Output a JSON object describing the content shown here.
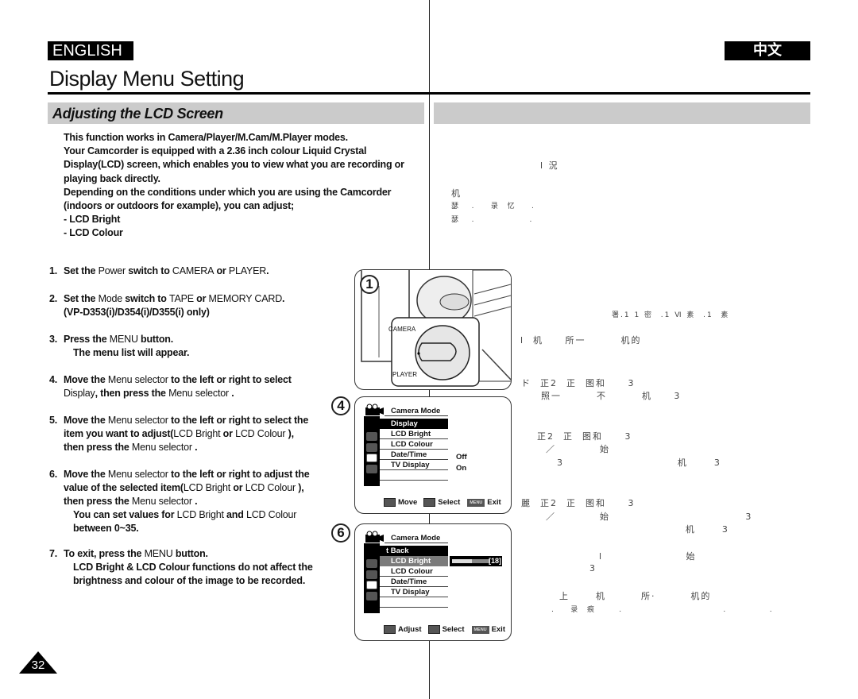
{
  "header": {
    "lang_left": "ENGLISH",
    "lang_right": "中文",
    "title": "Display Menu Setting",
    "section_title": "Adjusting the LCD Screen"
  },
  "intro": {
    "lines": [
      "This function works in Camera/Player/M.Cam/M.Player modes.",
      "Your Camcorder is equipped with a 2.36 inch colour Liquid Crystal",
      "Display(LCD) screen, which enables you to view what you are recording or",
      "playing back directly.",
      "Depending on the conditions under which you are using the Camcorder",
      "(indoors or outdoors for example), you can adjust;",
      "-  LCD Bright",
      "-  LCD Colour"
    ]
  },
  "steps": [
    {
      "num": "1.",
      "a": "Set the ",
      "b": "Power",
      "c": " switch to ",
      "d": "CAMERA",
      "e": " or ",
      "f": "PLAYER",
      "g": "."
    },
    {
      "num": "2.",
      "a": "Set the ",
      "b": "Mode",
      "c": " switch to ",
      "d": "TAPE",
      "e": " or ",
      "f": "MEMORY CARD",
      "g": ".",
      "sub": "(VP-D353(i)/D354(i)/D355(i) only)"
    },
    {
      "num": "3.",
      "a": "Press the ",
      "b": "MENU",
      "c": " button.",
      "sub": "The menu list will appear."
    },
    {
      "num": "4.",
      "a": "Move the ",
      "b": "Menu selector",
      "c": " to the left or right to select",
      "d2": "Display",
      "e2": ", then press the ",
      "f2": "Menu selector",
      "g2": " ."
    },
    {
      "num": "5.",
      "a": "Move the ",
      "b": "Menu selector",
      "c": " to the left or right to select the",
      "l2a": "item you want to adjust(",
      "l2b": "LCD Bright",
      "l2c": " or ",
      "l2d": "LCD Colour",
      "l2e": " ),",
      "l3a": "then press the ",
      "l3b": "Menu selector",
      "l3c": " ."
    },
    {
      "num": "6.",
      "a": "Move the ",
      "b": "Menu selector",
      "c": " to the left or right to adjust the",
      "l2a": "value of the selected item(",
      "l2b": "LCD Bright",
      "l2c": " or ",
      "l2d": "LCD Colour",
      "l2e": " ),",
      "l3a": "then press the ",
      "l3b": "Menu selector",
      "l3c": " .",
      "s1a": "You can set values for ",
      "s1b": "LCD Bright",
      "s1c": " and ",
      "s1d": "LCD Colour",
      "s2": "between 0~35."
    },
    {
      "num": "7.",
      "a": "To exit, press the ",
      "b": "MENU",
      "c": " button.",
      "s1": "LCD Bright & LCD Colour functions do not affect the",
      "s2": "brightness and colour of the image to be recorded."
    }
  ],
  "figures": {
    "fig1": {
      "label": "1",
      "dial_top": "CAMERA",
      "dial_bottom": "PLAYER"
    },
    "fig4": {
      "label": "4",
      "header": "Camera Mode",
      "items": [
        "Display",
        "LCD Bright",
        "LCD Colour",
        "Date/Time",
        "TV Display"
      ],
      "selected": "Display",
      "values": {
        "Date/Time": "Off",
        "TV Display": "On"
      },
      "footer": {
        "move": "Move",
        "select": "Select",
        "menu_key": "MENU",
        "exit": "Exit"
      }
    },
    "fig6": {
      "label": "6",
      "header": "Camera Mode",
      "items": [
        "t Back",
        "LCD Bright",
        "LCD Colour",
        "Date/Time",
        "TV Display"
      ],
      "highlighted": "LCD Bright",
      "slider": {
        "value": 18,
        "min": 0,
        "max": 35,
        "label": "[18]"
      },
      "footer": {
        "adjust": "Adjust",
        "select": "Select",
        "menu_key": "MENU",
        "exit": "Exit"
      }
    }
  },
  "chinese_column": {
    "lines": [
      "l 況",
      "机",
      "瑟   .    录  忆    .",
      "瑟   .              .",
      "署.1 1 密  .1 Ⅵ 素  .1  素",
      "l  机     所一        机的",
      "ド  正2  正  图和     3",
      "  照一        不        机     3",
      "正2  正  图和     3",
      "  ／          始",
      "  3                          机      3",
      "麗  正2  正  图和     3",
      "  ／          始                               3",
      "                                  机      3",
      "l                   始",
      "3",
      "上      机        所·        机的",
      ".    录  痕      .                          .           ."
    ]
  },
  "page_number": "32"
}
